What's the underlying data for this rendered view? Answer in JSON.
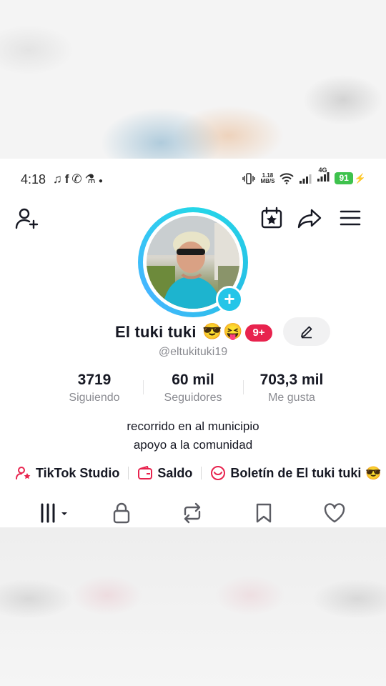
{
  "status_bar": {
    "time": "4:18",
    "left_icons": [
      "music-note-icon",
      "facebook-icon",
      "whatsapp-icon",
      "flask-icon",
      "dot-icon"
    ],
    "net_speed_value": "1.18",
    "net_speed_unit": "MB/S",
    "network_type": "4G",
    "battery": "91"
  },
  "profile": {
    "name": "El tuki tuki",
    "name_emojis": [
      "😎",
      "😝"
    ],
    "notification_badge": "9+",
    "handle": "@eltukituki19"
  },
  "stats": [
    {
      "value": "3719",
      "label": "Siguiendo"
    },
    {
      "value": "60 mil",
      "label": "Seguidores"
    },
    {
      "value": "703,3 mil",
      "label": "Me gusta"
    }
  ],
  "bio": {
    "line1": "recorrido en al municipio",
    "line2": "apoyo a la comunidad"
  },
  "links": {
    "studio": "TikTok Studio",
    "balance": "Saldo",
    "newsletter": "Boletín de El tuki tuki",
    "newsletter_emoji": "😎"
  },
  "colors": {
    "accent_pink": "#e8234e",
    "ring_cyan": "#25d6e8",
    "battery_green": "#3ec24d"
  },
  "tabs": [
    "videos-grid-icon",
    "lock-icon",
    "repost-icon",
    "bookmark-icon",
    "heart-icon"
  ]
}
